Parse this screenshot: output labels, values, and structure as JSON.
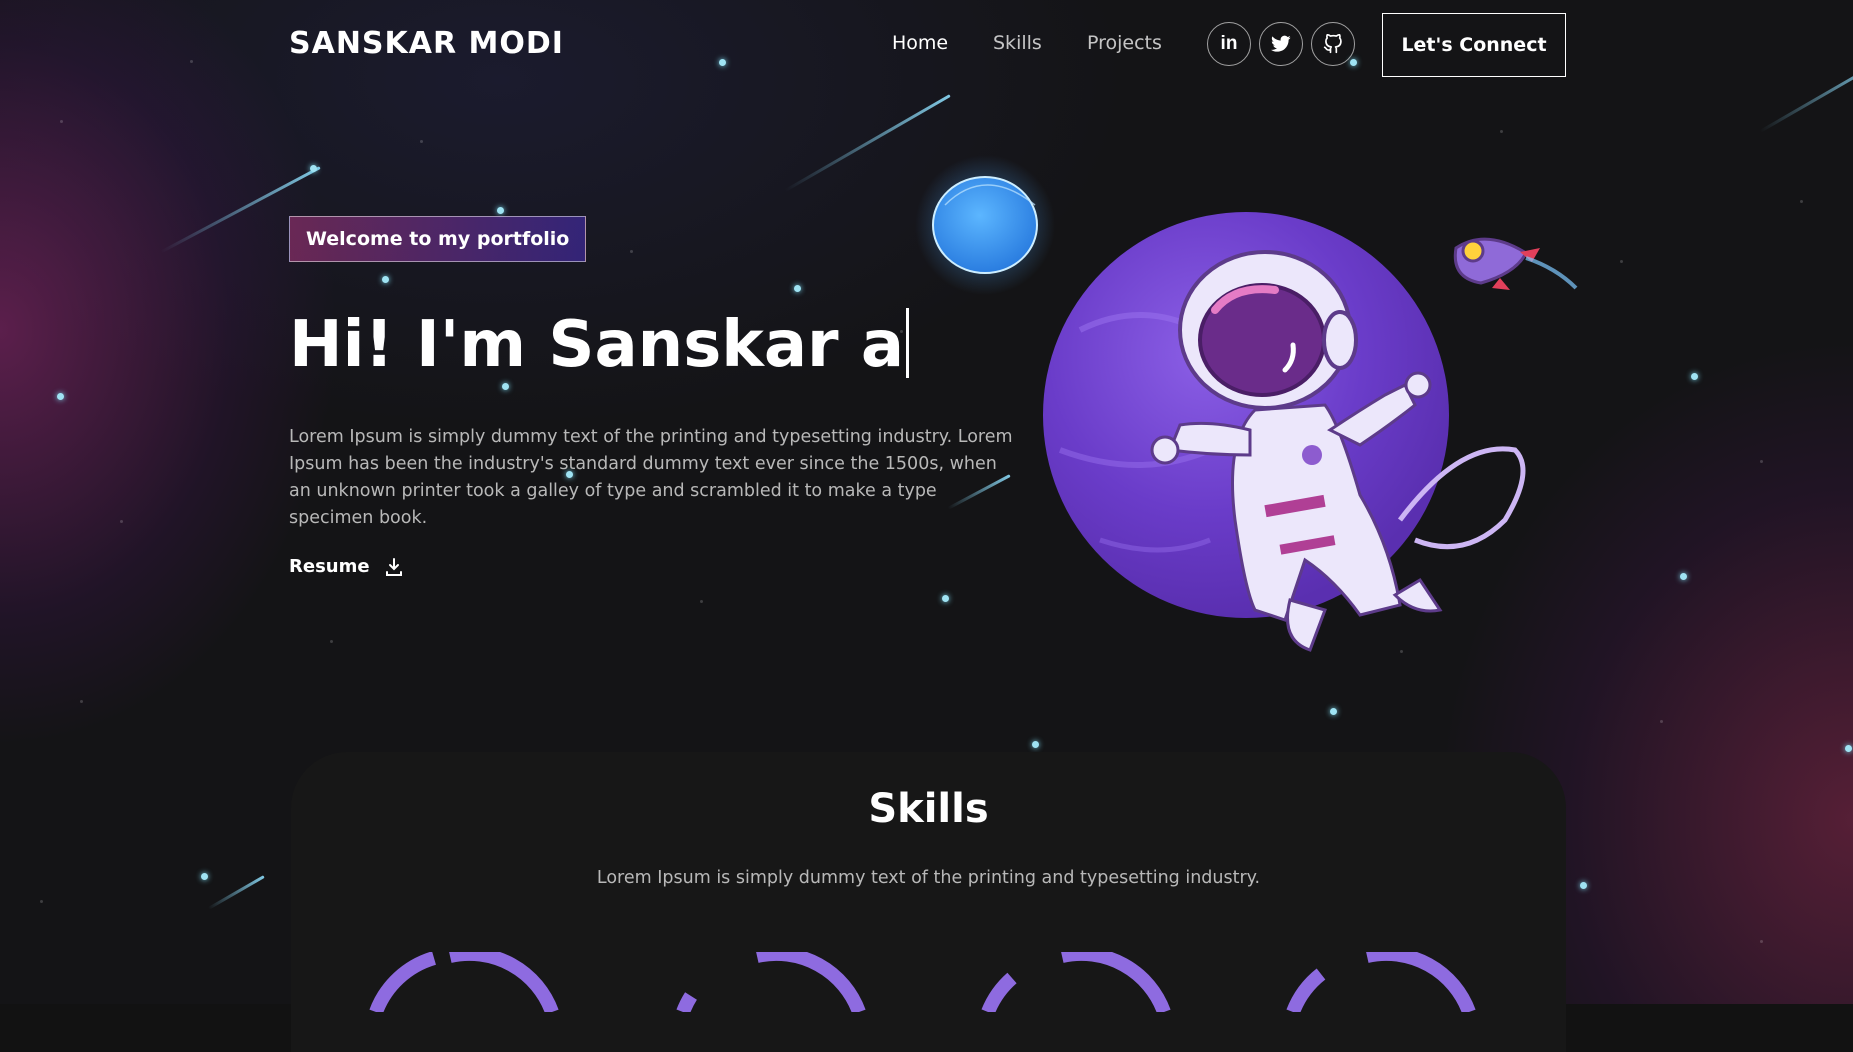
{
  "nav": {
    "brand": "SANSKAR MODI",
    "links": [
      "Home",
      "Skills",
      "Projects"
    ],
    "social_icons": [
      "linkedin-icon",
      "twitter-icon",
      "github-icon"
    ],
    "cta": "Let's Connect"
  },
  "hero": {
    "tagline": "Welcome to my portfolio",
    "headline": "Hi! I'm Sanskar a",
    "intro": "Lorem Ipsum is simply dummy text of the printing and typesetting industry. Lorem Ipsum has been the industry's standard dummy text ever since the 1500s, when an unknown printer took a galley of type and scrambled it to make a type specimen book.",
    "resume_label": "Resume",
    "resume_icon": "download-icon",
    "illustration": "astronaut-on-planet"
  },
  "skills": {
    "title": "Skills",
    "subtitle": "Lorem Ipsum is simply dummy text of the printing and typesetting industry."
  },
  "colors": {
    "background": "#121212",
    "accent_purple": "#8e6be0",
    "tagline_gradient_start": "#aa367c",
    "tagline_gradient_end": "#4a2fbd",
    "star": "#9fe3f3"
  }
}
